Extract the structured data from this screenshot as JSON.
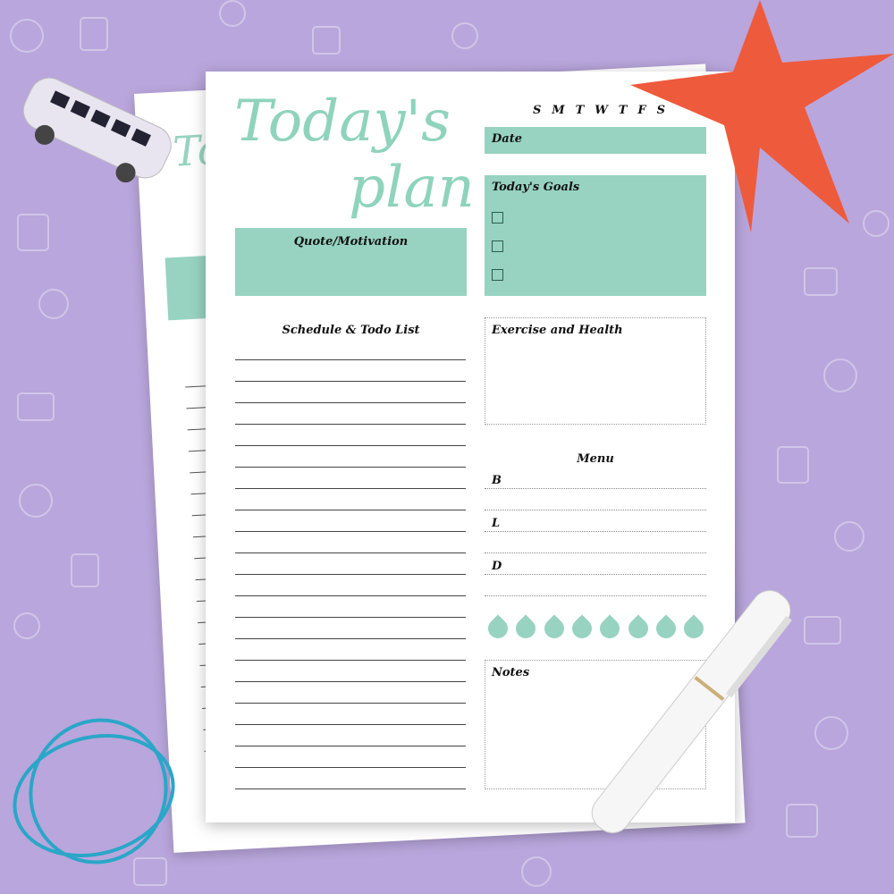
{
  "planner": {
    "title_line1": "Today's",
    "title_line2": "plan",
    "weekdays": [
      "S",
      "M",
      "T",
      "W",
      "T",
      "F",
      "S"
    ],
    "date_label": "Date",
    "goals_label": "Today's Goals",
    "goals_checkboxes": 3,
    "quote_label": "Quote/Motivation",
    "schedule_label": "Schedule & Todo List",
    "exercise_label": "Exercise and Health",
    "menu_label": "Menu",
    "menu_items": [
      "B",
      "L",
      "D"
    ],
    "water_drops": 8,
    "notes_label": "Notes"
  },
  "colors": {
    "accent": "#97d3c0",
    "background": "#b9a6dc",
    "starfish": "#ee5a3c",
    "rubber_band": "#2aa6c8"
  }
}
